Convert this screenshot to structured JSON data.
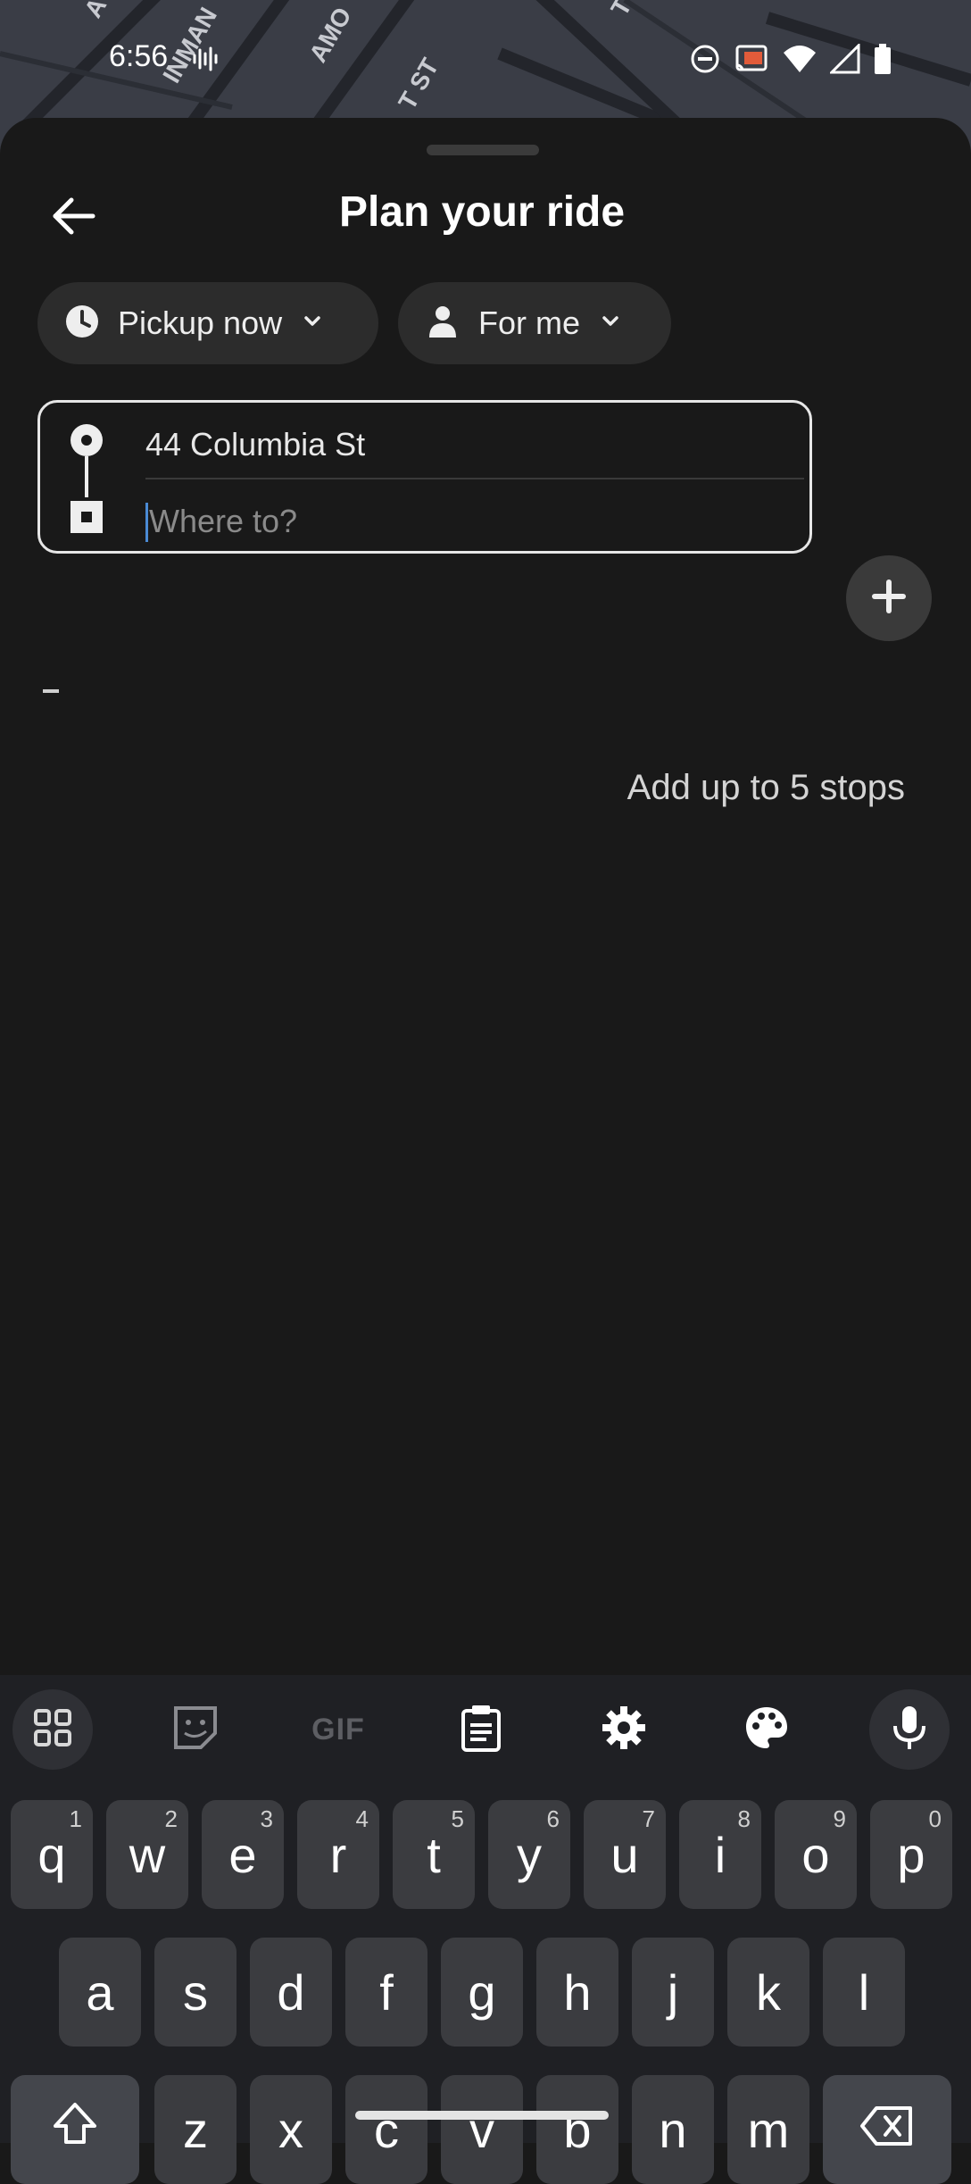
{
  "status_bar": {
    "time": "6:56",
    "icons": [
      "voice-activity-icon",
      "dnd-icon",
      "cast-icon",
      "wifi-icon",
      "cell-signal-icon",
      "battery-icon"
    ]
  },
  "map": {
    "street_labels": [
      "A",
      "INMAN",
      "AMO",
      "T ST",
      "T"
    ]
  },
  "header": {
    "title": "Plan your ride",
    "back_icon": "arrow-left-icon"
  },
  "chips": {
    "pickup": {
      "label": "Pickup now",
      "icon": "clock-icon"
    },
    "rider": {
      "label": "For me",
      "icon": "person-icon"
    }
  },
  "route": {
    "pickup_value": "44 Columbia St",
    "destination_value": "",
    "destination_placeholder": "Where to?"
  },
  "add_stop": {
    "icon": "plus-icon",
    "hint": "Add up to 5 stops"
  },
  "keyboard": {
    "toolbar": [
      "apps-grid-icon",
      "sticker-icon",
      "GIF",
      "clipboard-icon",
      "settings-icon",
      "palette-icon",
      "mic-icon"
    ],
    "gif_label": "GIF",
    "row1": [
      {
        "k": "q",
        "s": "1"
      },
      {
        "k": "w",
        "s": "2"
      },
      {
        "k": "e",
        "s": "3"
      },
      {
        "k": "r",
        "s": "4"
      },
      {
        "k": "t",
        "s": "5"
      },
      {
        "k": "y",
        "s": "6"
      },
      {
        "k": "u",
        "s": "7"
      },
      {
        "k": "i",
        "s": "8"
      },
      {
        "k": "o",
        "s": "9"
      },
      {
        "k": "p",
        "s": "0"
      }
    ],
    "row2": [
      "a",
      "s",
      "d",
      "f",
      "g",
      "h",
      "j",
      "k",
      "l"
    ],
    "row3": [
      "z",
      "x",
      "c",
      "v",
      "b",
      "n",
      "m"
    ]
  },
  "colors": {
    "sheet": "#191919",
    "chip": "#2c2c2c",
    "keyboard": "#1f2024",
    "key": "#3b3c40",
    "cursor": "#4a8ad4"
  }
}
